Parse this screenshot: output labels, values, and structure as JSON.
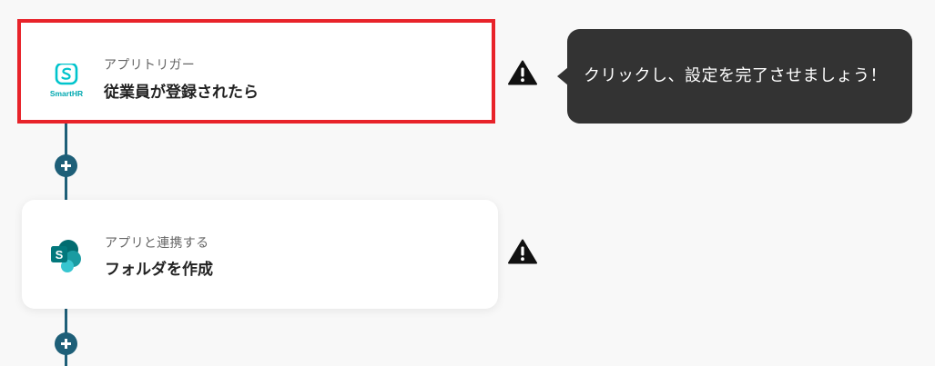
{
  "steps": [
    {
      "subtitle": "アプリトリガー",
      "title": "従業員が登録されたら",
      "app_icon": "smarthr-logo",
      "app_icon_text": "SmartHR",
      "status_icon": "warning-icon"
    },
    {
      "subtitle": "アプリと連携する",
      "title": "フォルダを作成",
      "app_icon": "sharepoint-logo",
      "app_icon_text": "S",
      "status_icon": "warning-icon"
    }
  ],
  "tooltip": {
    "text": "クリックし、設定を完了させましょう！"
  },
  "colors": {
    "background": "#f8f8f8",
    "connector": "#1e5f78",
    "selected_border": "#e8232a",
    "tooltip_bg": "#333333",
    "smarthr_teal": "#00c4cc",
    "sharepoint_teal": "#038387"
  }
}
